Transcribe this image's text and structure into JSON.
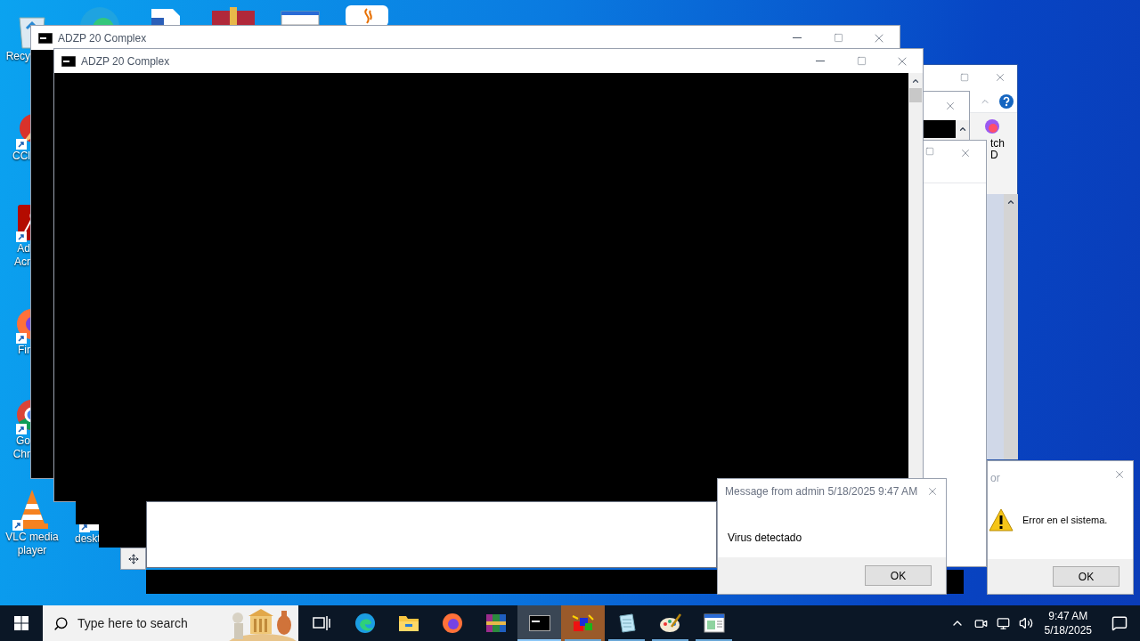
{
  "desktop_icons": [
    {
      "kind": "recycle",
      "lines": [
        "Recy"
      ]
    },
    {
      "kind": "ccleaner",
      "lines": [
        "CCl"
      ]
    },
    {
      "kind": "acrobat",
      "lines": [
        "Ad",
        "Acr"
      ]
    },
    {
      "kind": "firefox",
      "lines": [
        "Fir"
      ]
    },
    {
      "kind": "chrome",
      "lines": [
        "Go",
        "Chr"
      ]
    },
    {
      "kind": "vlc",
      "lines": [
        "VLC media",
        "player"
      ]
    },
    {
      "kind": "file",
      "lines": [
        "deskt"
      ]
    }
  ],
  "console_windows": [
    {
      "title": "ADZP 20 Complex"
    },
    {
      "title": "ADZP 20 Complex"
    }
  ],
  "partial_window": {
    "text_lines": [
      "tch",
      "D"
    ]
  },
  "message_box": {
    "title": "Message from admin 5/18/2025 9:47 AM",
    "message": "Virus detectado",
    "button": "OK"
  },
  "error_box": {
    "title": "or",
    "message": "Error en el sistema.",
    "button": "OK"
  },
  "taskbar": {
    "search": {
      "placeholder": "Type here to search"
    },
    "apps": [
      {
        "kind": "task-view",
        "running": false,
        "selected": false,
        "flashing": false
      },
      {
        "kind": "edge",
        "running": false,
        "selected": false,
        "flashing": false
      },
      {
        "kind": "explorer",
        "running": false,
        "selected": false,
        "flashing": false
      },
      {
        "kind": "firefox",
        "running": false,
        "selected": false,
        "flashing": false
      },
      {
        "kind": "winrar",
        "running": false,
        "selected": false,
        "flashing": false
      },
      {
        "kind": "console",
        "running": true,
        "selected": true,
        "flashing": false
      },
      {
        "kind": "cubes",
        "running": true,
        "selected": false,
        "flashing": true
      },
      {
        "kind": "notepad",
        "running": true,
        "selected": false,
        "flashing": false
      },
      {
        "kind": "paint",
        "running": true,
        "selected": false,
        "flashing": false
      },
      {
        "kind": "window-app",
        "running": true,
        "selected": false,
        "flashing": false
      }
    ],
    "time": "9:47 AM",
    "date": "5/18/2025"
  }
}
